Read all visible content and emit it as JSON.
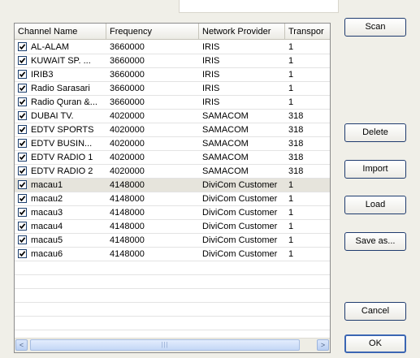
{
  "columns": [
    "Channel Name",
    "Frequency",
    "Network Provider",
    "Transpor"
  ],
  "rows": [
    {
      "name": "AL-ALAM",
      "frequency": "3660000",
      "provider": "IRIS",
      "transponder": "1",
      "checked": true
    },
    {
      "name": "KUWAIT SP. ...",
      "frequency": "3660000",
      "provider": "IRIS",
      "transponder": "1",
      "checked": true
    },
    {
      "name": "IRIB3",
      "frequency": "3660000",
      "provider": "IRIS",
      "transponder": "1",
      "checked": true
    },
    {
      "name": "Radio Sarasari",
      "frequency": "3660000",
      "provider": "IRIS",
      "transponder": "1",
      "checked": true
    },
    {
      "name": "Radio Quran &...",
      "frequency": "3660000",
      "provider": "IRIS",
      "transponder": "1",
      "checked": true
    },
    {
      "name": "DUBAI TV.",
      "frequency": "4020000",
      "provider": "SAMACOM",
      "transponder": "318",
      "checked": true
    },
    {
      "name": "EDTV SPORTS",
      "frequency": "4020000",
      "provider": "SAMACOM",
      "transponder": "318",
      "checked": true
    },
    {
      "name": "EDTV BUSIN...",
      "frequency": "4020000",
      "provider": "SAMACOM",
      "transponder": "318",
      "checked": true
    },
    {
      "name": "EDTV RADIO 1",
      "frequency": "4020000",
      "provider": "SAMACOM",
      "transponder": "318",
      "checked": true
    },
    {
      "name": "EDTV RADIO 2",
      "frequency": "4020000",
      "provider": "SAMACOM",
      "transponder": "318",
      "checked": true
    },
    {
      "name": "macau1",
      "frequency": "4148000",
      "provider": "DiviCom Customer",
      "transponder": "1",
      "checked": true,
      "selected": true
    },
    {
      "name": "macau2",
      "frequency": "4148000",
      "provider": "DiviCom Customer",
      "transponder": "1",
      "checked": true
    },
    {
      "name": "macau3",
      "frequency": "4148000",
      "provider": "DiviCom Customer",
      "transponder": "1",
      "checked": true
    },
    {
      "name": "macau4",
      "frequency": "4148000",
      "provider": "DiviCom Customer",
      "transponder": "1",
      "checked": true
    },
    {
      "name": "macau5",
      "frequency": "4148000",
      "provider": "DiviCom Customer",
      "transponder": "1",
      "checked": true
    },
    {
      "name": "macau6",
      "frequency": "4148000",
      "provider": "DiviCom Customer",
      "transponder": "1",
      "checked": true
    }
  ],
  "empty_rows": 5,
  "buttons": {
    "scan": "Scan",
    "delete": "Delete",
    "import": "Import",
    "load": "Load",
    "save_as": "Save as...",
    "cancel": "Cancel",
    "ok": "OK"
  },
  "scrollbar": {
    "left_arrow": "<",
    "right_arrow": ">",
    "thumb_grip": "|||"
  },
  "colors": {
    "selected_row": "#e6e4dc",
    "button_border": "#1f3b6e",
    "dialog_bg": "#f0efe8"
  }
}
